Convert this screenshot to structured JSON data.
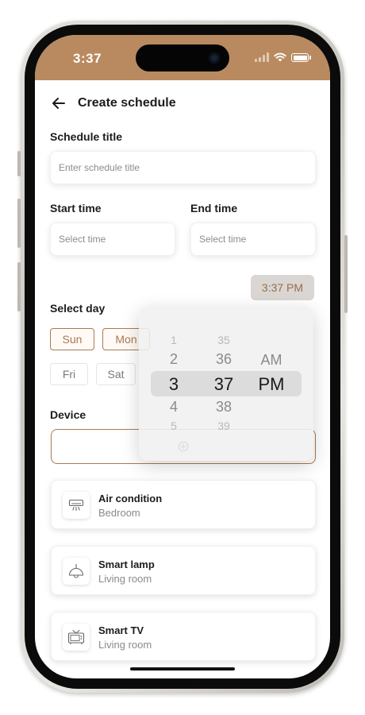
{
  "status": {
    "time": "3:37"
  },
  "header": {
    "title": "Create schedule"
  },
  "form": {
    "schedule_title_label": "Schedule title",
    "schedule_title_placeholder": "Enter schedule title",
    "start_time_label": "Start time",
    "start_time_placeholder": "Select time",
    "end_time_label": "End time",
    "end_time_placeholder": "Select time",
    "selected_time": "3:37 PM"
  },
  "days": {
    "label": "Select day",
    "items": [
      {
        "label": "Sun",
        "selected": true
      },
      {
        "label": "Mon",
        "selected": true
      },
      {
        "label": "Fri",
        "selected": false
      },
      {
        "label": "Sat",
        "selected": false
      }
    ]
  },
  "device_section": {
    "label": "Device"
  },
  "devices": [
    {
      "name": "Air condition",
      "room": "Bedroom",
      "icon": "air-conditioner-icon"
    },
    {
      "name": "Smart lamp",
      "room": "Living room",
      "icon": "lamp-icon"
    },
    {
      "name": "Smart TV",
      "room": "Living room",
      "icon": "tv-icon"
    }
  ],
  "picker": {
    "hours": [
      "1",
      "2",
      "3",
      "4",
      "5"
    ],
    "minutes": [
      "35",
      "36",
      "37",
      "38",
      "39"
    ],
    "periods": [
      "AM",
      "PM"
    ],
    "selected_hour": "3",
    "selected_minute": "37",
    "selected_period": "PM"
  },
  "colors": {
    "accent": "#a97a50",
    "status_bar": "#b98a5f"
  }
}
